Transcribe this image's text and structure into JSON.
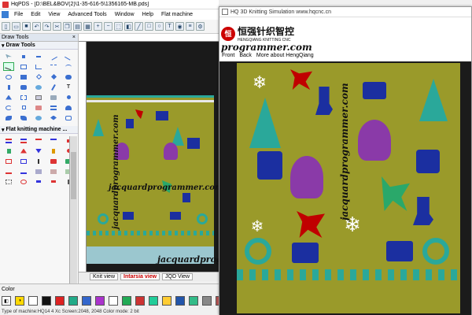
{
  "app": {
    "title": "HqPDS - [D:\\BEL&BOV(2)\\1-35-616-5\\1356165-MB.pds]"
  },
  "menubar": {
    "items": [
      "File",
      "Edit",
      "View",
      "Advanced Tools",
      "Window",
      "Help",
      "Flat machine"
    ]
  },
  "left_panel": {
    "header": "Draw Tools",
    "close": "×",
    "section1": "Draw Tools",
    "section2": "Flat knitting machine ..."
  },
  "view_tabs": {
    "items": [
      "Knit view",
      "Intarsia view",
      "JQD View"
    ],
    "active": "Intarsia view"
  },
  "color_bar": {
    "label": "Color",
    "status": "Type of machine:HQ14    4 Xc     Screen:2048, 2048     Color mode: 2 bit"
  },
  "simulation": {
    "title": "HQ 3D Knitting Simulation   www.hqcnc.cn",
    "logo_text": "恒强针织智控",
    "logo_sub": "HENGQIANG KNITTING CNC",
    "menu": [
      "Front",
      "Back",
      "More about HengQiang"
    ],
    "watermark_top": "programmer.com"
  },
  "watermarks": {
    "a": "jacquardprogrammer.com",
    "b": "jacquardprogrammer.com",
    "c": "jacquardprogrammer.com",
    "d": "jacquardprogrammer.com"
  },
  "colors": {
    "knit_bg": "#9a9a2a",
    "accent_red": "#c00000",
    "teal": "#2aa89a",
    "purple": "#8a3aa8",
    "blue": "#1b2fa0"
  }
}
